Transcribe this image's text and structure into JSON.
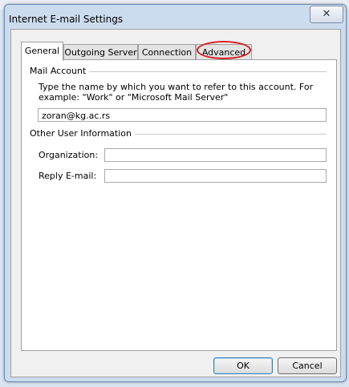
{
  "dialog": {
    "title": "Internet E-mail Settings",
    "close_glyph": "✕"
  },
  "tabs": [
    {
      "label": "General",
      "active": true
    },
    {
      "label": "Outgoing Server",
      "active": false
    },
    {
      "label": "Connection",
      "active": false
    },
    {
      "label": "Advanced",
      "active": false,
      "highlighted": true
    }
  ],
  "mail_account": {
    "section_label": "Mail Account",
    "description": "Type the name by which you want to refer to this account. For example: \"Work\" or \"Microsoft Mail Server\"",
    "account_name_value": "zoran@kg.ac.rs"
  },
  "other_user_info": {
    "section_label": "Other User Information",
    "organization_label": "Organization:",
    "organization_value": "",
    "reply_email_label": "Reply E-mail:",
    "reply_email_value": ""
  },
  "buttons": {
    "ok_label": "OK",
    "cancel_label": "Cancel"
  },
  "colors": {
    "highlight_ring": "#d71c24",
    "dialog_frame": "#cbdcee"
  }
}
